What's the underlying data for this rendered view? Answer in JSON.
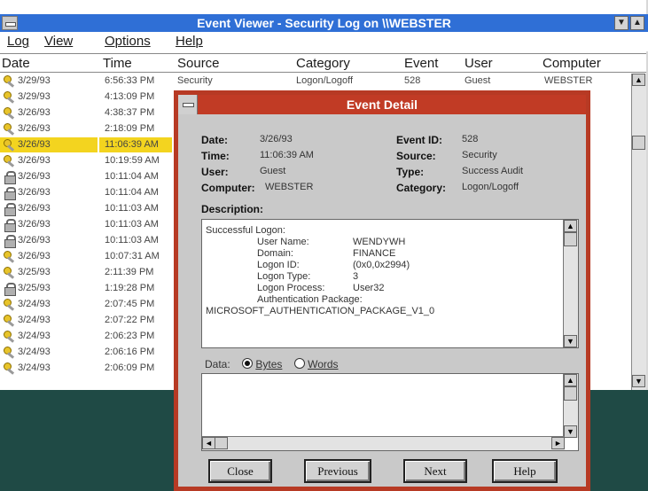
{
  "window": {
    "title": "Event Viewer - Security Log on \\\\WEBSTER",
    "minimize_glyph": "▼",
    "maximize_glyph": "▲"
  },
  "menu": {
    "items": [
      "Log",
      "View",
      "Options",
      "Help"
    ]
  },
  "columns": [
    "Date",
    "Time",
    "Source",
    "Category",
    "Event",
    "User",
    "Computer"
  ],
  "first_row": {
    "source": "Security",
    "category": "Logon/Logoff",
    "event": "528",
    "user": "Guest",
    "computer": "WEBSTER"
  },
  "rows": [
    {
      "icon": "key-icon",
      "date": "3/29/93",
      "time": "6:56:33 PM"
    },
    {
      "icon": "key-icon",
      "date": "3/29/93",
      "time": "4:13:09 PM"
    },
    {
      "icon": "key-icon",
      "date": "3/26/93",
      "time": "4:38:37 PM"
    },
    {
      "icon": "key-icon",
      "date": "3/26/93",
      "time": "2:18:09 PM"
    },
    {
      "icon": "key-icon",
      "date": "3/26/93",
      "time": "11:06:39 AM",
      "selected": true
    },
    {
      "icon": "key-icon",
      "date": "3/26/93",
      "time": "10:19:59 AM"
    },
    {
      "icon": "lock-icon",
      "date": "3/26/93",
      "time": "10:11:04 AM"
    },
    {
      "icon": "lock-icon",
      "date": "3/26/93",
      "time": "10:11:04 AM"
    },
    {
      "icon": "lock-icon",
      "date": "3/26/93",
      "time": "10:11:03 AM"
    },
    {
      "icon": "lock-icon",
      "date": "3/26/93",
      "time": "10:11:03 AM"
    },
    {
      "icon": "lock-icon",
      "date": "3/26/93",
      "time": "10:11:03 AM"
    },
    {
      "icon": "key-icon",
      "date": "3/26/93",
      "time": "10:07:31 AM"
    },
    {
      "icon": "key-icon",
      "date": "3/25/93",
      "time": "2:11:39 PM"
    },
    {
      "icon": "lock-icon",
      "date": "3/25/93",
      "time": "1:19:28 PM"
    },
    {
      "icon": "key-icon",
      "date": "3/24/93",
      "time": "2:07:45 PM"
    },
    {
      "icon": "key-icon",
      "date": "3/24/93",
      "time": "2:07:22 PM"
    },
    {
      "icon": "key-icon",
      "date": "3/24/93",
      "time": "2:06:23 PM"
    },
    {
      "icon": "key-icon",
      "date": "3/24/93",
      "time": "2:06:16 PM"
    },
    {
      "icon": "key-icon",
      "date": "3/24/93",
      "time": "2:06:09 PM"
    }
  ],
  "dialog": {
    "title": "Event Detail",
    "date_label": "Date:",
    "date_value": "3/26/93",
    "time_label": "Time:",
    "time_value": "11:06:39 AM",
    "user_label": "User:",
    "user_value": "Guest",
    "computer_label": "Computer:",
    "computer_value": "WEBSTER",
    "event_id_label": "Event ID:",
    "event_id_value": "528",
    "source_label": "Source:",
    "source_value": "Security",
    "type_label": "Type:",
    "type_value": "Success Audit",
    "category_label": "Category:",
    "category_value": "Logon/Logoff",
    "description_label": "Description:",
    "description_lines": [
      "Successful Logon:",
      "User Name:",
      "Domain:",
      "Logon ID:",
      "Logon Type:",
      "Logon Process:",
      "Authentication Package:",
      "MICROSOFT_AUTHENTICATION_PACKAGE_V1_0"
    ],
    "description_values": [
      "WENDYWH",
      "FINANCE",
      "(0x0,0x2994)",
      "3",
      "User32"
    ],
    "data_label": "Data:",
    "bytes_label": "Bytes",
    "words_label": "Words",
    "buttons": {
      "close": "Close",
      "previous": "Previous",
      "next": "Next",
      "help": "Help"
    }
  }
}
